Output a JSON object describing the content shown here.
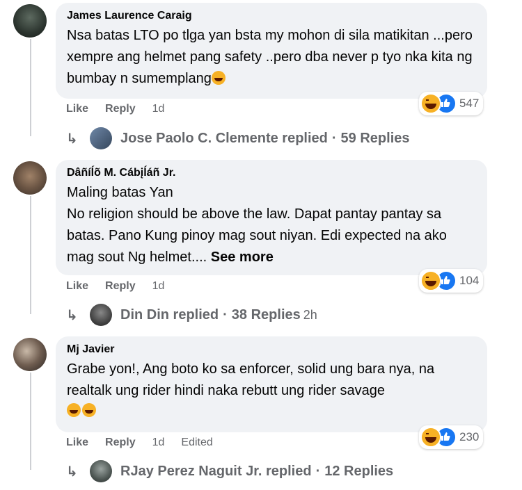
{
  "comments": [
    {
      "author": "James Laurence Caraig",
      "text": "Nsa batas LTO po tlga yan bsta my mohon di sila matikitan ...pero xempre ang helmet pang safety ..pero dba never p tyo nka kita ng bumbay n sumemplang",
      "actions": {
        "like": "Like",
        "reply": "Reply",
        "time": "1d"
      },
      "reaction_count": "547",
      "reply_summary": {
        "name": "Jose Paolo C. Clemente replied",
        "sep": "·",
        "count": "59 Replies",
        "time": ""
      }
    },
    {
      "author": "Dâñíĺõ M. Cábįĺáñ Jr.",
      "text": "Maling batas Yan\nNo religion should be above the law. Dapat pantay pantay sa batas. Pano Kung pinoy mag sout niyan. Edi expected na ako mag sout Ng helmet....",
      "see_more": "See more",
      "actions": {
        "like": "Like",
        "reply": "Reply",
        "time": "1d"
      },
      "reaction_count": "104",
      "reply_summary": {
        "name": "Din Din replied",
        "sep": "·",
        "count": "38 Replies",
        "time": "2h"
      }
    },
    {
      "author": "Mj Javier",
      "text": "Grabe yon!, Ang boto ko sa enforcer, solid ung bara nya, na realtalk ung rider hindi naka rebutt ung rider savage",
      "actions": {
        "like": "Like",
        "reply": "Reply",
        "time": "1d",
        "edited": "Edited"
      },
      "reaction_count": "230",
      "reply_summary": {
        "name": "RJay Perez Naguit Jr. replied",
        "sep": "·",
        "count": "12 Replies",
        "time": ""
      }
    }
  ],
  "icons": {
    "reply_arrow": "↳",
    "reaction_haha": "haha-emoji",
    "reaction_like": "like-thumb"
  },
  "colors": {
    "bubble": "#f0f2f5",
    "meta": "#65676b",
    "like_blue": "#1877f2",
    "haha_yellow": "#f7b125"
  }
}
